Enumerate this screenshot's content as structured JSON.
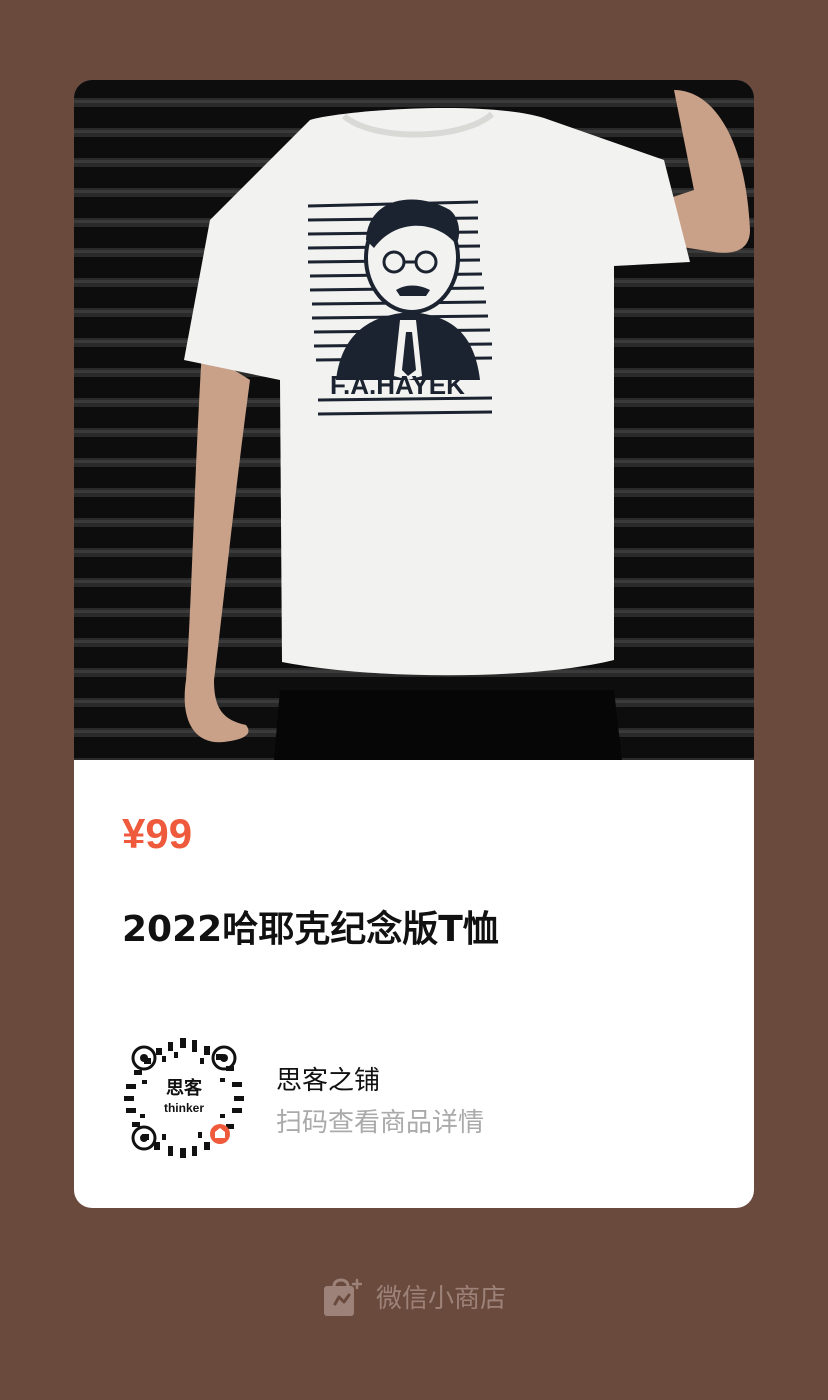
{
  "product": {
    "price": "¥99",
    "title": "2022哈耶克纪念版T恤",
    "print_text": "F.A.HAYEK"
  },
  "shop": {
    "name": "思客之铺",
    "scan_hint": "扫码查看商品详情",
    "qr_logo_cn": "思客",
    "qr_logo_en": "thinker"
  },
  "footer": {
    "label": "微信小商店",
    "icon": "shopping-bag-icon"
  },
  "colors": {
    "background": "#6b4a3e",
    "price": "#ef5a3c",
    "card": "#ffffff",
    "footer_text": "#9c8278"
  }
}
